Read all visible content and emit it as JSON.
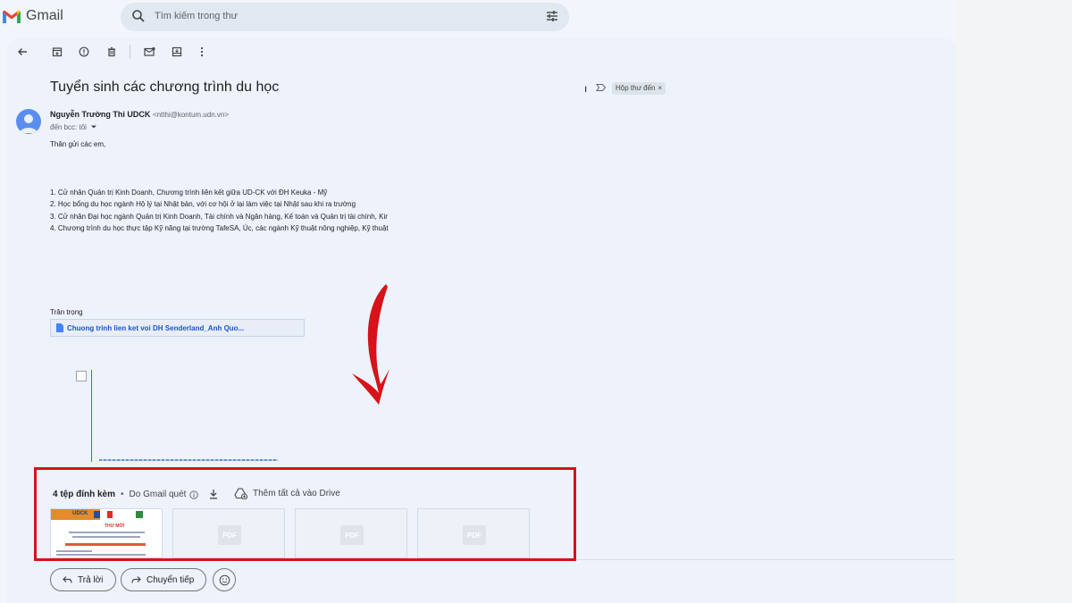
{
  "app": {
    "brand": "Gmail"
  },
  "search": {
    "placeholder": "Tìm kiếm trong thư"
  },
  "toolbar": {
    "icons": [
      "back-arrow-icon",
      "archive-icon",
      "report-spam-icon",
      "delete-icon",
      "mark-unread-icon",
      "move-to-icon",
      "more-vert-icon"
    ]
  },
  "email": {
    "subject": "Tuyển sinh các chương trình du học",
    "subject_tail": "ı",
    "label": "Hộp thư đến",
    "label_close": "×",
    "sender_name": "Nguyễn Trường Thi UDCK",
    "sender_email": "<ntthi@kontum.udn.vn>",
    "recipient": "đến bcc: tôi",
    "greeting": "Thân gửi các em,",
    "items": [
      "1. Cử nhân Quản trị Kinh Doanh, Chương trình liên kết giữa UD-CK với ĐH Keuka - Mỹ",
      "2. Học bổng du học ngành Hộ lý tại Nhật bản, với cơ hội ở lại làm việc tại Nhật sau khi ra trường",
      "3. Cử nhân Đại học ngành Quản trị Kinh Doanh, Tài chính và Ngân hàng, Kế toán và Quản trị tài chính, Kir",
      "4. Chương trình du học thực tập Kỹ năng tại trường TafeSA, Úc, các ngành Kỹ thuật nông nghiệp, Kỹ thuật"
    ],
    "closing": "Trân trọng",
    "drive_link": "Chuong trinh lien ket voi DH Senderland_Anh Quo..."
  },
  "attachments": {
    "count_label": "4 tệp đính kèm",
    "separator": "•",
    "scan_label": "Do Gmail quét",
    "add_drive_label": "Thêm tất cả vào Drive",
    "thumbs": [
      {
        "type": "image",
        "banner": "THƯ MỜI",
        "logo": "UDCK"
      },
      {
        "type": "pdf",
        "mark": "PDF"
      },
      {
        "type": "pdf",
        "mark": "PDF"
      },
      {
        "type": "pdf",
        "mark": "PDF"
      }
    ]
  },
  "actions": {
    "reply": "Trả lời",
    "forward": "Chuyển tiếp"
  },
  "colors": {
    "highlight_box": "#d6121a",
    "arrow": "#d6121a"
  }
}
